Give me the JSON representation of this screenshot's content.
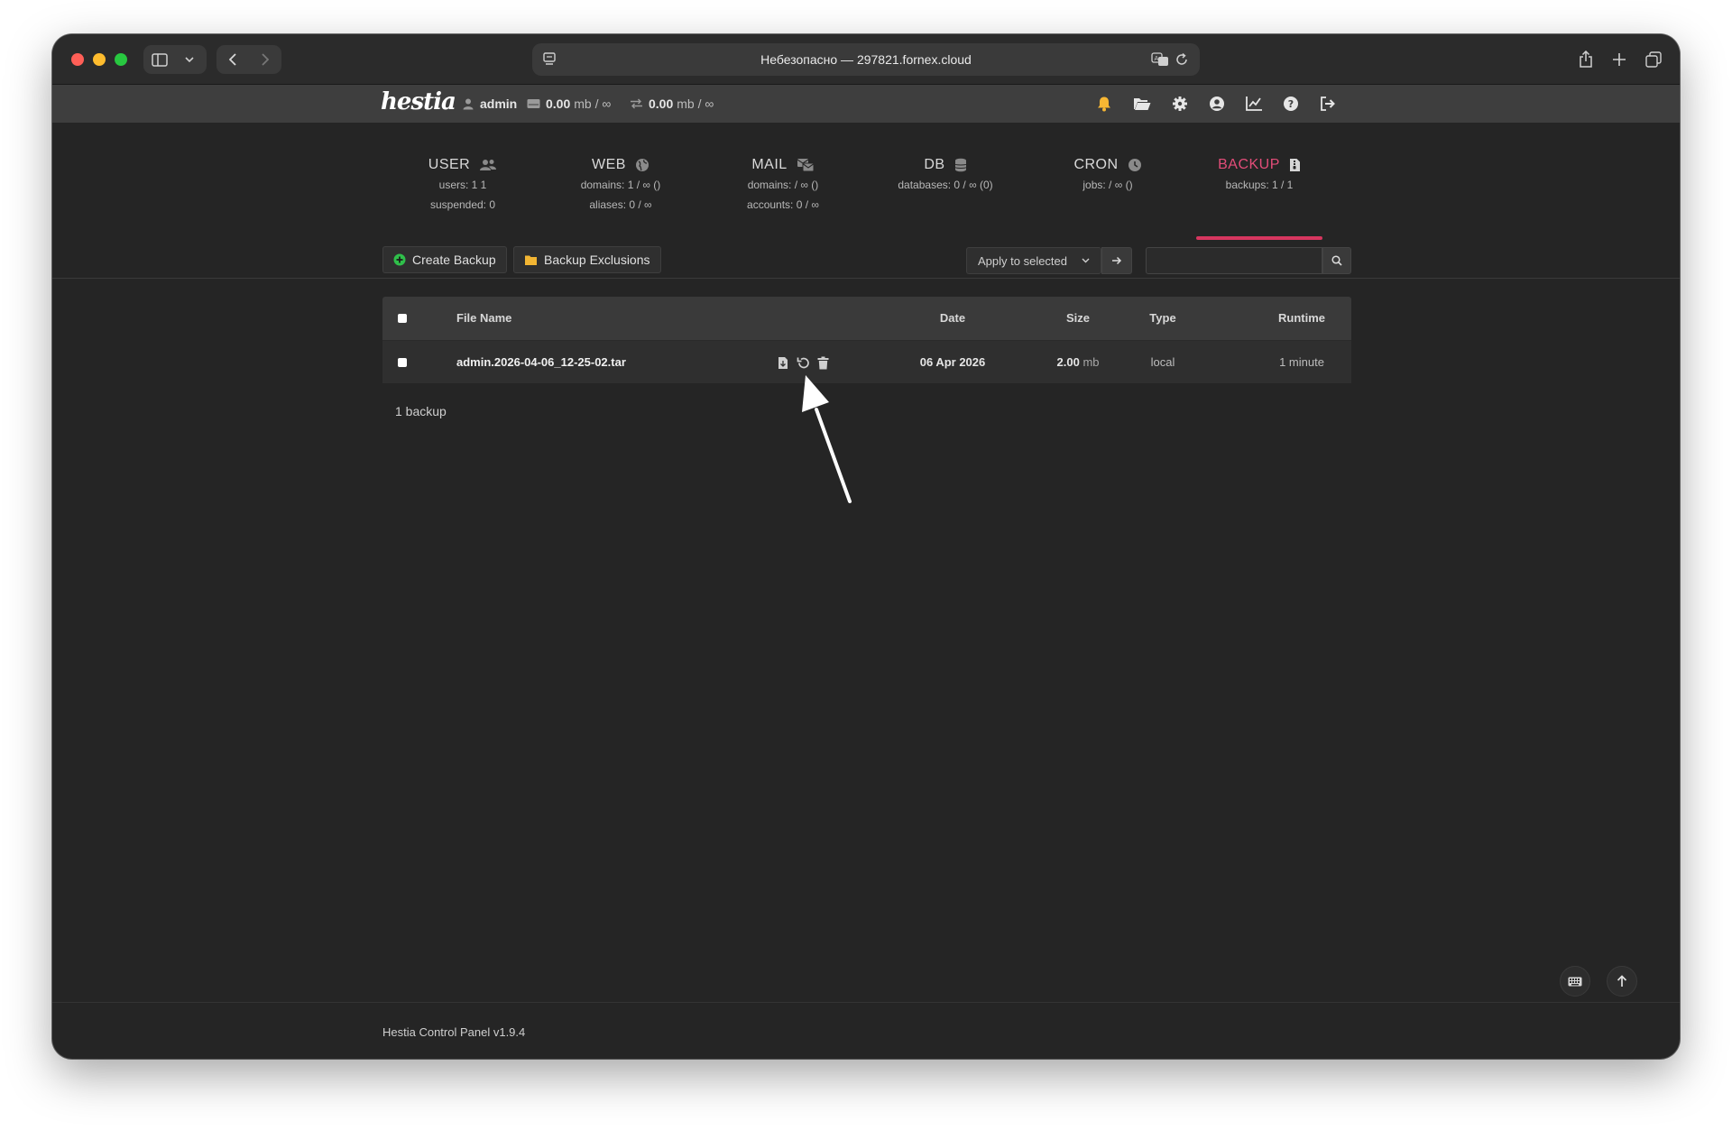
{
  "browser": {
    "address": "Небезопасно — 297821.fornex.cloud"
  },
  "header": {
    "logo": "hestia",
    "user": "admin",
    "disk_usage": "0.00",
    "disk_unit": "mb / ∞",
    "bandwidth_usage": "0.00",
    "bandwidth_unit": "mb / ∞"
  },
  "stats": [
    {
      "title": "USER",
      "line1": "users: 1 1",
      "line2": "suspended: 0",
      "icon": "users-icon",
      "active": false
    },
    {
      "title": "WEB",
      "line1": "domains: 1 / ∞ ()",
      "line2": "aliases: 0 / ∞",
      "icon": "globe-icon",
      "active": false
    },
    {
      "title": "MAIL",
      "line1": "domains: / ∞ ()",
      "line2": "accounts: 0 / ∞",
      "icon": "mail-icon",
      "active": false
    },
    {
      "title": "DB",
      "line1": "databases: 0 / ∞ (0)",
      "line2": "",
      "icon": "database-icon",
      "active": false
    },
    {
      "title": "CRON",
      "line1": "jobs: / ∞ ()",
      "line2": "",
      "icon": "clock-icon",
      "active": false
    },
    {
      "title": "BACKUP",
      "line1": "backups: 1 / 1",
      "line2": "",
      "icon": "file-archive-icon",
      "active": true
    }
  ],
  "toolbar": {
    "create_backup": "Create Backup",
    "backup_exclusions": "Backup Exclusions",
    "bulk_action": "Apply to selected",
    "search_value": ""
  },
  "table": {
    "columns": {
      "file_name": "File Name",
      "date": "Date",
      "size": "Size",
      "type": "Type",
      "runtime": "Runtime"
    },
    "rows": [
      {
        "file_name": "admin.2026-04-06_12-25-02.tar",
        "date": "06 Apr 2026",
        "size": "2.00",
        "size_unit": "mb",
        "type": "local",
        "runtime": "1 minute"
      }
    ]
  },
  "summary": "1 backup",
  "footer": "Hestia Control Panel v1.9.4",
  "colors": {
    "accent": "#e34d79",
    "background": "#252525",
    "header": "#3e3e3e",
    "bell": "#f7b733",
    "create_icon": "#2fbf4a",
    "folder_icon": "#f2b533"
  }
}
